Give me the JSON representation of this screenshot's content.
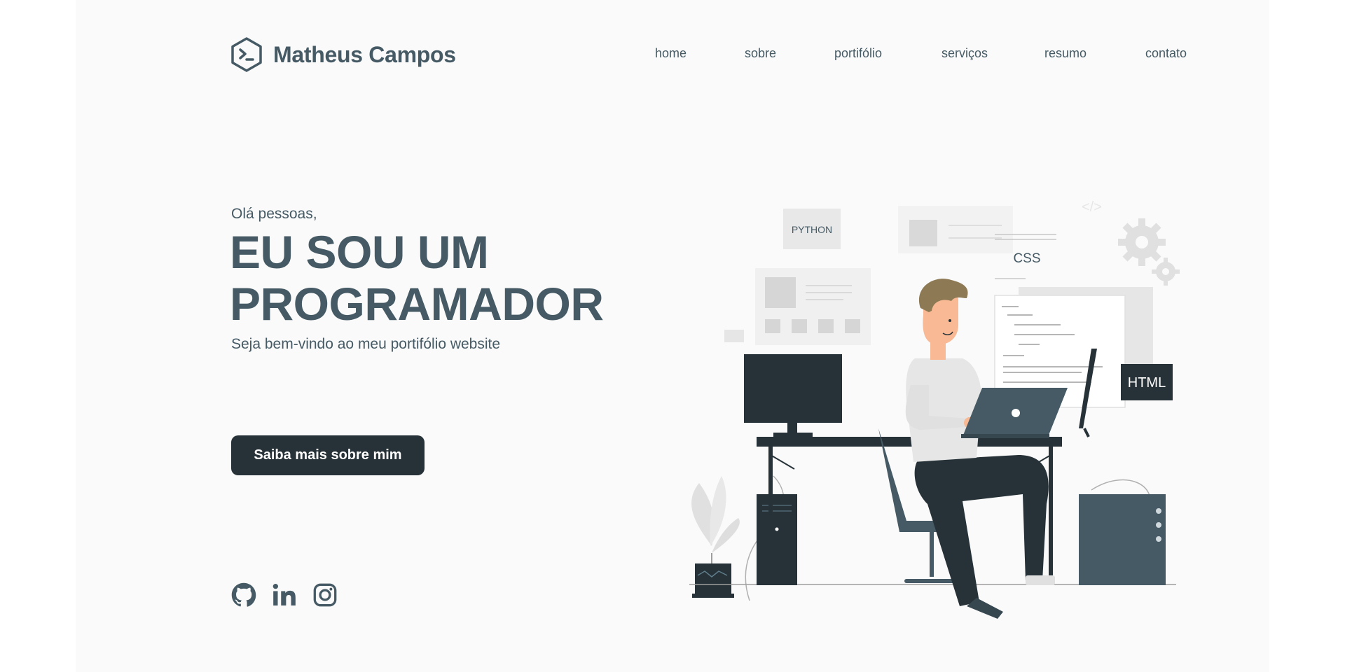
{
  "header": {
    "brand_name": "Matheus Campos",
    "nav": [
      {
        "label": "home"
      },
      {
        "label": "sobre"
      },
      {
        "label": "portifólio"
      },
      {
        "label": "serviços"
      },
      {
        "label": "resumo"
      },
      {
        "label": "contato"
      }
    ]
  },
  "hero": {
    "greeting": "Olá pessoas,",
    "title_line1": "EU SOU UM",
    "title_line2": "PROGRAMADOR",
    "subtitle": "Seja bem-vindo ao meu portifólio website",
    "cta_label": "Saiba mais sobre mim"
  },
  "social": [
    {
      "icon": "github-icon"
    },
    {
      "icon": "linkedin-icon"
    },
    {
      "icon": "instagram-icon"
    }
  ],
  "illustration": {
    "tag_python": "PYTHON",
    "tag_css": "CSS",
    "tag_html": "HTML"
  },
  "colors": {
    "primary": "#455a64",
    "dark": "#263238",
    "background": "#fafafa"
  }
}
